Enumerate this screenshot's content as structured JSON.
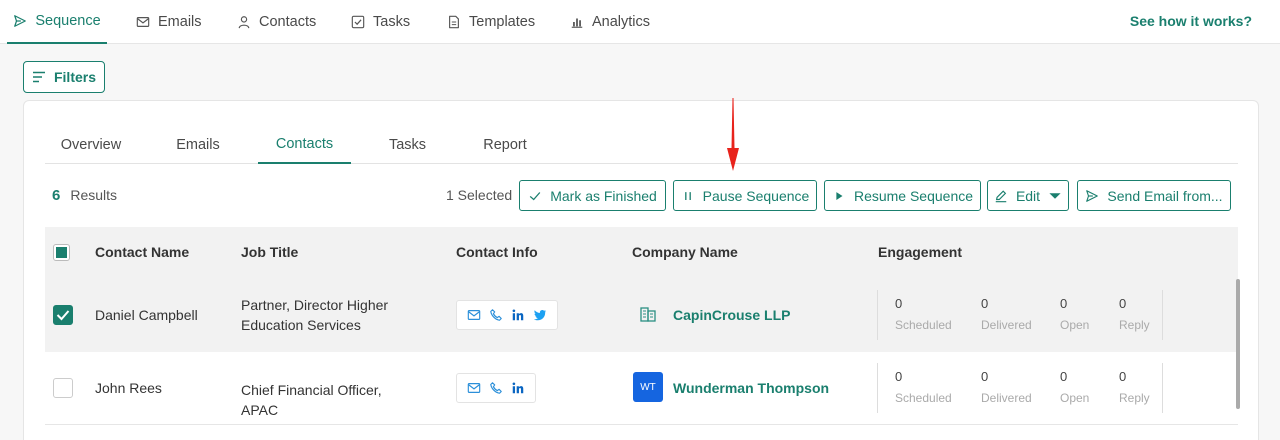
{
  "topnav": {
    "tabs": [
      {
        "label": "Sequence",
        "icon": "send-icon"
      },
      {
        "label": "Emails",
        "icon": "mail-icon"
      },
      {
        "label": "Contacts",
        "icon": "person-icon"
      },
      {
        "label": "Tasks",
        "icon": "checkbox-icon"
      },
      {
        "label": "Templates",
        "icon": "document-icon"
      },
      {
        "label": "Analytics",
        "icon": "bar-chart-icon"
      }
    ],
    "help_link": "See how it works?"
  },
  "filters_label": "Filters",
  "subtabs": [
    "Overview",
    "Emails",
    "Contacts",
    "Tasks",
    "Report"
  ],
  "results": {
    "count": "6",
    "label": "Results"
  },
  "selected_text": "1 Selected",
  "actions": {
    "mark_finished": "Mark as Finished",
    "pause": "Pause Sequence",
    "resume": "Resume Sequence",
    "edit": "Edit",
    "send_email": "Send Email from..."
  },
  "table": {
    "headers": [
      "Contact Name",
      "Job Title",
      "Contact Info",
      "Company Name",
      "Engagement"
    ],
    "engagement_labels": [
      "Scheduled",
      "Delivered",
      "Open",
      "Reply"
    ],
    "rows": [
      {
        "name": "Daniel Campbell",
        "job_line1": "Partner, Director Higher",
        "job_line2": "Education Services",
        "company": "CapinCrouse LLP",
        "company_logo_text": "",
        "checked": true,
        "stats": [
          "0",
          "0",
          "0",
          "0"
        ]
      },
      {
        "name": "John Rees",
        "job_line1": "Chief Financial Officer, APAC",
        "job_line2": "",
        "company": "Wunderman Thompson",
        "company_logo_text": "WT",
        "checked": false,
        "stats": [
          "0",
          "0",
          "0",
          "0"
        ]
      }
    ]
  },
  "colors": {
    "accent": "#1a7f6e",
    "arrow": "#e8231c",
    "wt_logo": "#1565e0",
    "linkedin": "#0a66c2",
    "twitter": "#1da1f2"
  }
}
